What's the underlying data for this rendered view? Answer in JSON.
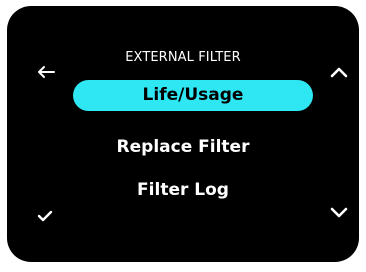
{
  "screen": {
    "title": "EXTERNAL FILTER",
    "menu": [
      {
        "label": "Life/Usage",
        "selected": true
      },
      {
        "label": "Replace Filter",
        "selected": false
      },
      {
        "label": "Filter Log",
        "selected": false
      }
    ],
    "icons": {
      "back": "arrow-left-icon",
      "up": "chevron-up-icon",
      "down": "chevron-down-icon",
      "confirm": "checkmark-icon"
    },
    "colors": {
      "background": "#000000",
      "highlight": "#2fe6f3",
      "text": "#ffffff"
    }
  }
}
